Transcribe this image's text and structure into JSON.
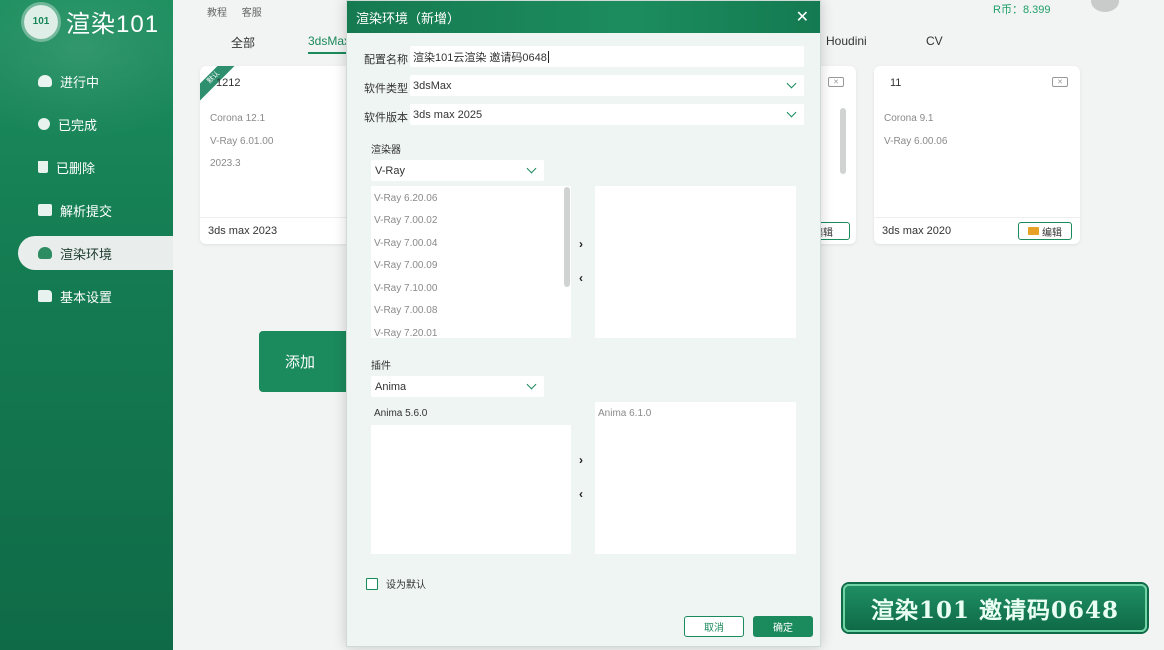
{
  "app": {
    "logo_badge": "101",
    "logo_text": "渲染101"
  },
  "sidebar": {
    "items": [
      {
        "label": "进行中",
        "icon": "cloud-icon"
      },
      {
        "label": "已完成",
        "icon": "check-icon"
      },
      {
        "label": "已删除",
        "icon": "trash-icon"
      },
      {
        "label": "解析提交",
        "icon": "camera-icon"
      },
      {
        "label": "渲染环境",
        "icon": "cloud-icon",
        "active": true
      },
      {
        "label": "基本设置",
        "icon": "folder-icon"
      }
    ]
  },
  "topbar": {
    "links": [
      "教程",
      "客服"
    ],
    "balance": "R币：8.399"
  },
  "tabs": [
    "全部",
    "3dsMax",
    "Houdini",
    "CV"
  ],
  "cards": [
    {
      "badge": "默认",
      "title": "1212",
      "specs": [
        "Corona 12.1",
        "V-Ray 6.01.00",
        "2023.3"
      ],
      "version": "3ds max 2023"
    },
    {
      "title": "11",
      "specs": [
        "Corona 9.1",
        "V-Ray 6.00.06"
      ],
      "version": "3ds max 2020",
      "edit_label": "编辑"
    }
  ],
  "card_partial_edit": "编辑",
  "add_button": "添加",
  "promo": "渲染101 邀请码0648",
  "dialog": {
    "title": "渲染环境（新增）",
    "close": "✕",
    "config_name_label": "配置名称",
    "config_name_value": "渲染101云渲染  邀请码0648",
    "software_type_label": "软件类型",
    "software_type_value": "3dsMax",
    "software_version_label": "软件版本",
    "software_version_value": "3ds max 2025",
    "renderer_label": "渲染器",
    "renderer_value": "V-Ray",
    "renderer_available": [
      "V-Ray 6.20.06",
      "V-Ray 7.00.02",
      "V-Ray 7.00.04",
      "V-Ray 7.00.09",
      "V-Ray 7.10.00",
      "V-Ray 7.00.08",
      "V-Ray 7.20.01"
    ],
    "plugin_label": "插件",
    "plugin_value": "Anima",
    "plugin_available": [
      "Anima 5.6.0"
    ],
    "plugin_selected": [
      "Anima 6.1.0"
    ],
    "arrow_right": "›",
    "arrow_left": "‹",
    "default_checkbox_label": "设为默认",
    "cancel": "取消",
    "ok": "确定"
  }
}
